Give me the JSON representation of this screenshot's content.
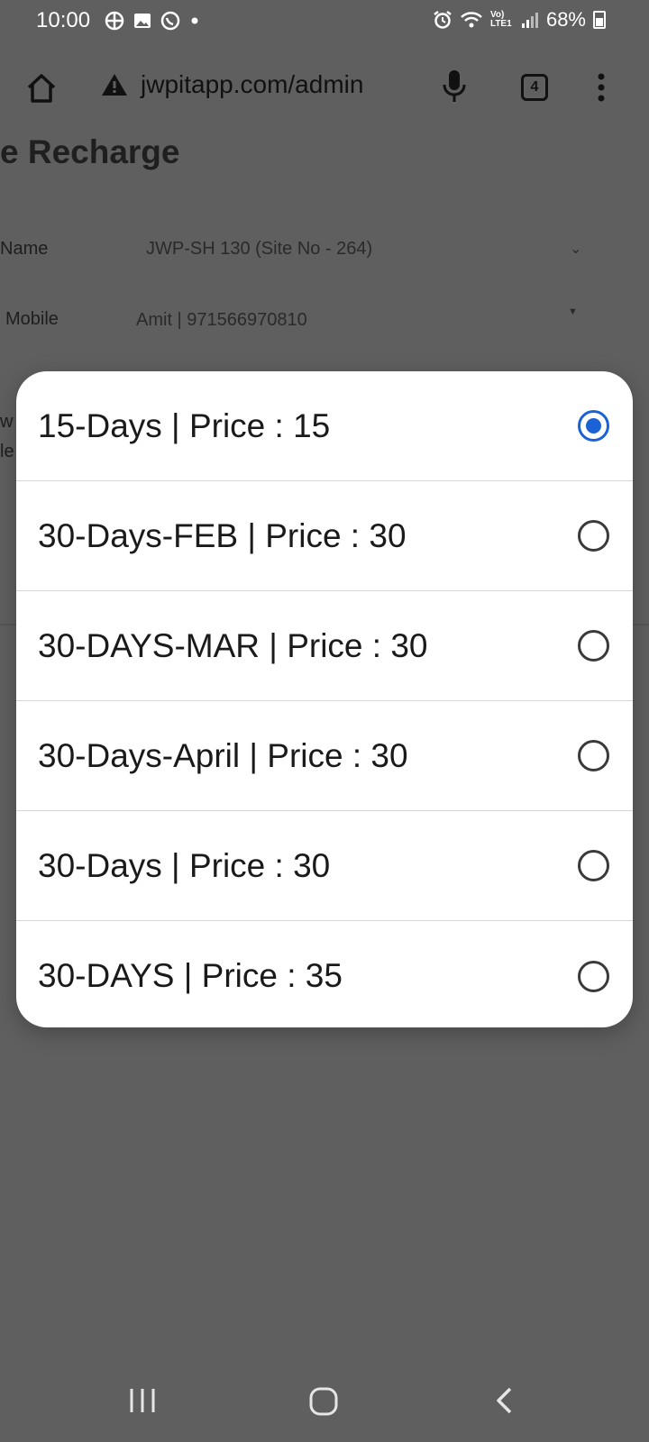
{
  "status_bar": {
    "time": "10:00",
    "battery": "68%",
    "notification_icons": [
      "fan-icon",
      "gallery-icon",
      "whatsapp-icon",
      "dot-icon"
    ],
    "system_icons": [
      "alarm-icon",
      "wifi-icon",
      "volte-icon",
      "signal-icon",
      "battery-icon"
    ],
    "volte_label": "Vo) LTE1"
  },
  "browser": {
    "url": "jwpitapp.com/admin",
    "tab_count": "4"
  },
  "page": {
    "title": "e Recharge",
    "fields": [
      {
        "label": "Name",
        "value": "JWP-SH 130 (Site No - 264)"
      },
      {
        "label": "Mobile",
        "value": "Amit | 971566970810"
      }
    ],
    "partial_labels": [
      "w",
      "le"
    ]
  },
  "dialog": {
    "selected_index": 0,
    "options": [
      {
        "label": "15-Days | Price : 15",
        "selected": true
      },
      {
        "label": "30-Days-FEB | Price : 30",
        "selected": false
      },
      {
        "label": "30-DAYS-MAR | Price : 30",
        "selected": false
      },
      {
        "label": "30-Days-April | Price : 30",
        "selected": false
      },
      {
        "label": "30-Days | Price : 30",
        "selected": false
      },
      {
        "label": "30-DAYS | Price : 35",
        "selected": false
      }
    ]
  },
  "colors": {
    "scrim": "#5f5f5f",
    "accent": "#1a62d6",
    "dialog_bg": "#ffffff"
  }
}
